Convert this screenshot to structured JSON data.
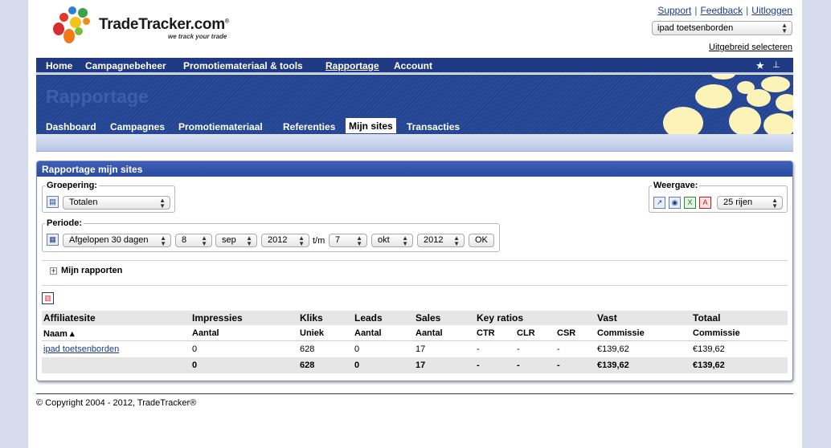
{
  "brand": {
    "name": "TradeTracker.com",
    "tagline": "we track your trade",
    "registered": "®"
  },
  "toplinks": {
    "support": "Support",
    "feedback": "Feedback",
    "logout": "Uitloggen",
    "separator": "|"
  },
  "site_select": {
    "value": "ipad toetsenborden"
  },
  "advanced_select": "Uitgebreid selecteren",
  "main_nav": {
    "items": [
      "Home",
      "Campagnebeheer",
      "Promotiemateriaal & tools",
      "Rapportage",
      "Account"
    ],
    "active": "Rapportage",
    "icons": [
      "star-icon",
      "sitemap-icon"
    ]
  },
  "banner": {
    "title": "Rapportage"
  },
  "sub_nav": {
    "items": [
      "Dashboard",
      "Campagnes",
      "Promotiemateriaal",
      "Referenties",
      "Mijn sites",
      "Transacties"
    ],
    "active": "Mijn sites"
  },
  "panel": {
    "title": "Rapportage mijn sites",
    "grouping": {
      "legend": "Groepering:",
      "value": "Totalen"
    },
    "view": {
      "legend": "Weergave:",
      "rows": "25 rijen",
      "export_icons": [
        "spreadsheet-export-icon",
        "web-export-icon",
        "excel-icon",
        "pdf-icon"
      ]
    },
    "period": {
      "legend": "Periode:",
      "range": "Afgelopen 30 dagen",
      "from_day": "8",
      "from_month": "sep",
      "from_year": "2012",
      "until_label": "t/m",
      "to_day": "7",
      "to_month": "okt",
      "to_year": "2012",
      "ok": "OK"
    },
    "my_reports": "Mijn rapporten"
  },
  "table": {
    "header1": [
      "Affiliatesite",
      "Impressies",
      "Kliks",
      "Leads",
      "Sales",
      "Key ratios",
      "Vast",
      "Totaal"
    ],
    "header2": [
      "Naam ▴",
      "Aantal",
      "Uniek",
      "Aantal",
      "Aantal",
      "CTR",
      "CLR",
      "CSR",
      "Commissie",
      "Commissie"
    ],
    "rows": [
      [
        "ipad toetsenborden",
        "0",
        "628",
        "0",
        "17",
        "-",
        "-",
        "-",
        "€139,62",
        "€139,62"
      ]
    ],
    "total": [
      "",
      "0",
      "628",
      "0",
      "17",
      "-",
      "-",
      "-",
      "€139,62",
      "€139,62"
    ]
  },
  "footer": {
    "copyright": "© Copyright 2004 - 2012, TradeTracker®"
  }
}
